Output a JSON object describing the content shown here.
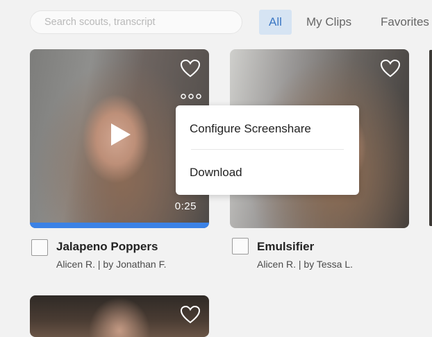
{
  "search": {
    "placeholder": "Search scouts, transcript",
    "value": ""
  },
  "tabs": [
    {
      "label": "All",
      "active": true
    },
    {
      "label": "My Clips",
      "active": false
    },
    {
      "label": "Favorites",
      "active": false
    }
  ],
  "clips": [
    {
      "title": "Jalapeno Poppers",
      "meta": "Alicen R. | by Jonathan F.",
      "duration": "0:25",
      "progress": 1.0,
      "favorited": false,
      "thumbnail_icon": "play-icon"
    },
    {
      "title": "Emulsifier",
      "meta": "Alicen R. | by Tessa L.",
      "favorited": false
    },
    {
      "favorited": false
    }
  ],
  "context_menu": {
    "items": [
      {
        "label": "Configure Screenshare"
      },
      {
        "label": "Download"
      }
    ]
  },
  "colors": {
    "accent": "#3b82e6",
    "tab_active_bg": "#d6e4f3",
    "tab_active_text": "#3c78c4",
    "background": "#f2f2f2"
  },
  "icons": {
    "favorite": "heart-outline-icon",
    "more": "more-horizontal-icon",
    "play": "play-icon"
  }
}
